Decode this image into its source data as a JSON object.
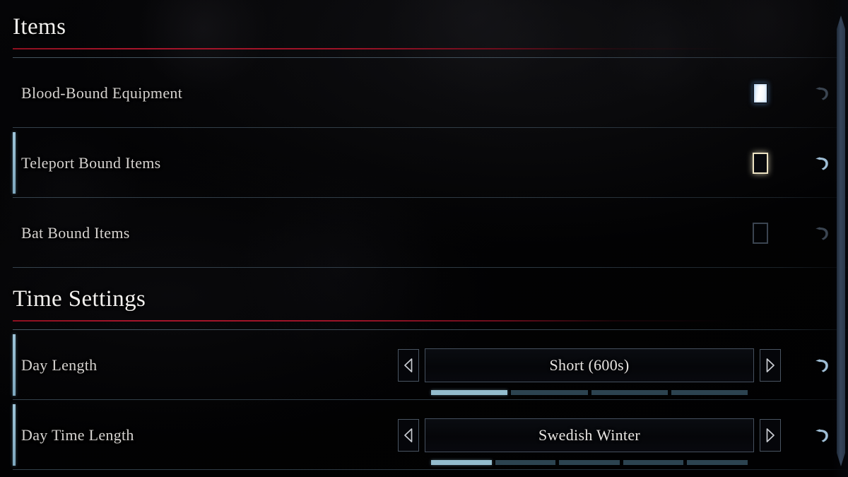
{
  "sections": [
    {
      "id": "items",
      "title": "Items",
      "rows": [
        {
          "label": "Blood-Bound Equipment",
          "control": "checkbox",
          "checkbox_state": "checked",
          "accent": false,
          "reset_state": "dim",
          "reset_icon": "undo-arrow-icon"
        },
        {
          "label": "Teleport Bound Items",
          "control": "checkbox",
          "checkbox_state": "hover",
          "accent": true,
          "reset_state": "bright",
          "reset_icon": "undo-arrow-icon"
        },
        {
          "label": "Bat Bound Items",
          "control": "checkbox",
          "checkbox_state": "unchecked",
          "accent": false,
          "reset_state": "dim",
          "reset_icon": "undo-arrow-icon"
        }
      ]
    },
    {
      "id": "time-settings",
      "title": "Time Settings",
      "rows": [
        {
          "label": "Day Length",
          "control": "stepper",
          "value": "Short (600s)",
          "segments_total": 4,
          "segments_filled": 1,
          "accent": true,
          "reset_state": "bright",
          "reset_icon": "undo-arrow-icon",
          "prev_icon": "chevron-left-icon",
          "next_icon": "chevron-right-icon"
        },
        {
          "label": "Day Time Length",
          "control": "stepper",
          "value": "Swedish Winter",
          "segments_total": 5,
          "segments_filled": 1,
          "accent": true,
          "reset_state": "bright",
          "reset_icon": "undo-arrow-icon",
          "prev_icon": "chevron-left-icon",
          "next_icon": "chevron-right-icon"
        }
      ]
    }
  ],
  "scrollbar": {
    "name": "vertical-scrollbar",
    "position_percent": 3
  },
  "colors": {
    "accent_red": "#a5142a",
    "accent_blue": "#93bccd",
    "highlight_gold": "#ece2c2",
    "checkbox_checked": "#ffffff",
    "segment_off": "#2c4350",
    "text_primary": "#f2f0ee",
    "text_row": "#d6d3d0",
    "background": "#020203"
  }
}
